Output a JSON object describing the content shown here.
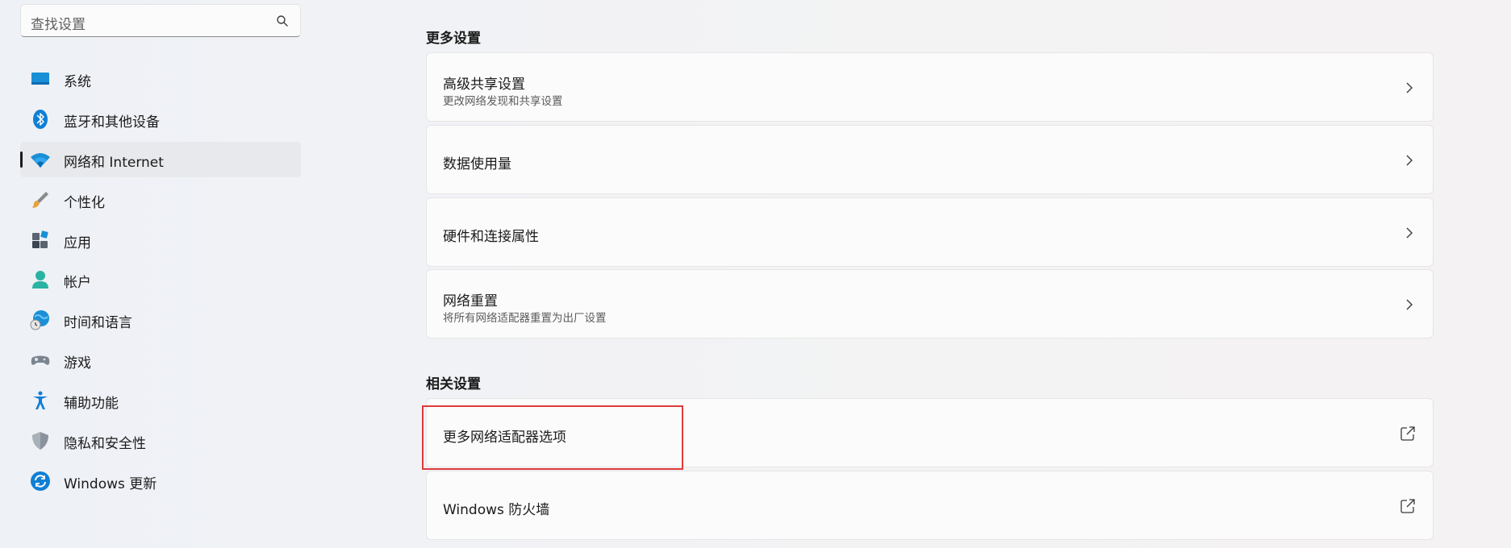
{
  "search": {
    "placeholder": "查找设置"
  },
  "sidebar": {
    "items": [
      {
        "label": "系统",
        "icon": "system-icon"
      },
      {
        "label": "蓝牙和其他设备",
        "icon": "bluetooth-icon"
      },
      {
        "label": "网络和 Internet",
        "icon": "wifi-icon",
        "active": true
      },
      {
        "label": "个性化",
        "icon": "brush-icon"
      },
      {
        "label": "应用",
        "icon": "apps-icon"
      },
      {
        "label": "帐户",
        "icon": "account-icon"
      },
      {
        "label": "时间和语言",
        "icon": "globe-clock-icon"
      },
      {
        "label": "游戏",
        "icon": "gamepad-icon"
      },
      {
        "label": "辅助功能",
        "icon": "accessibility-icon"
      },
      {
        "label": "隐私和安全性",
        "icon": "shield-icon"
      },
      {
        "label": "Windows 更新",
        "icon": "update-icon"
      }
    ]
  },
  "main": {
    "more_settings": {
      "title": "更多设置",
      "cards": [
        {
          "title": "高级共享设置",
          "subtitle": "更改网络发现和共享设置",
          "icon": "chevron-right-icon"
        },
        {
          "title": "数据使用量",
          "icon": "chevron-right-icon"
        },
        {
          "title": "硬件和连接属性",
          "icon": "chevron-right-icon"
        },
        {
          "title": "网络重置",
          "subtitle": "将所有网络适配器重置为出厂设置",
          "icon": "chevron-right-icon"
        }
      ]
    },
    "related_settings": {
      "title": "相关设置",
      "cards": [
        {
          "title": "更多网络适配器选项",
          "icon": "external-link-icon"
        },
        {
          "title": "Windows 防火墙",
          "icon": "external-link-icon"
        }
      ]
    }
  },
  "colors": {
    "highlight": "#e03a3a",
    "accent": "#0067c0"
  }
}
